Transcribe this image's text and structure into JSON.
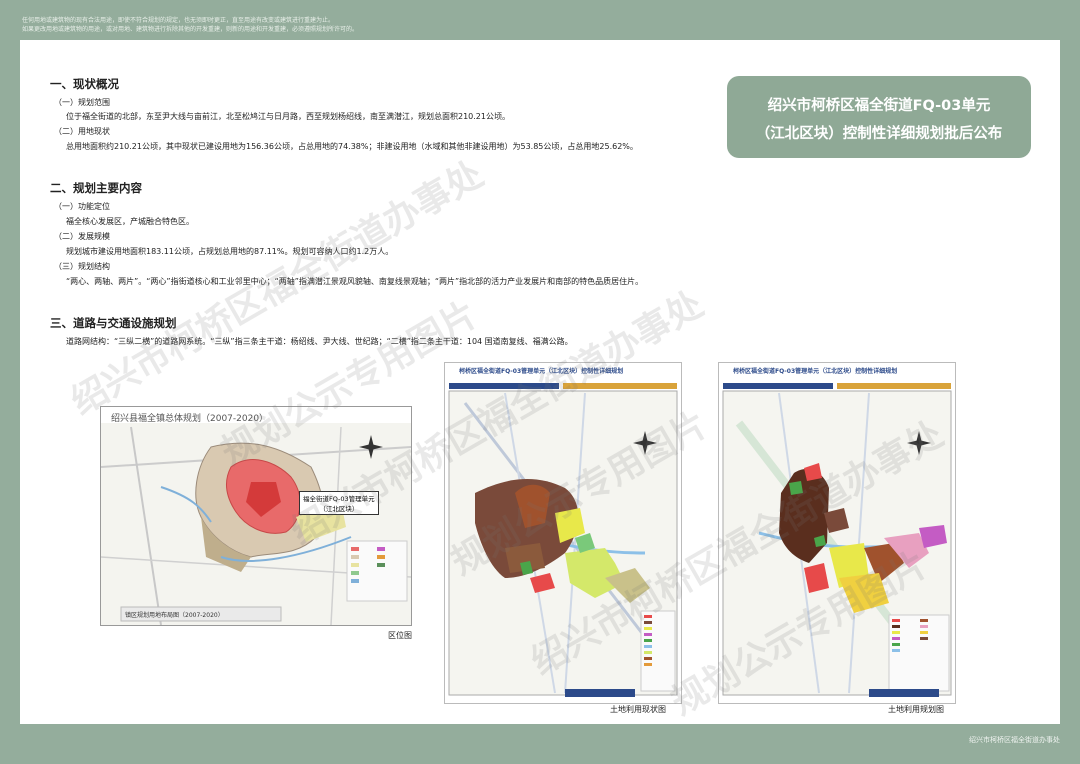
{
  "top_note": {
    "line1": "任何用地或建筑物的现有合法用途，即使不符合规划的规定，也无须即时更正，直至用途有改变或建筑进行重建为止。",
    "line2": "如果更改用地或建筑物的用途，或对用地、建筑物进行拆除其他的开发重建，则新的用途和开发重建，必须遵照规划所许可的。"
  },
  "title": {
    "line1": "绍兴市柯桥区福全街道FQ-03单元",
    "line2": "（江北区块）控制性详细规划批后公布"
  },
  "sections": {
    "s1": {
      "title": "一、现状概况",
      "sub1_label": "（一）规划范围",
      "sub1_text": "位于福全街道的北部，东至尹大线与亩前江，北至松鸠江与日月路，西至规划杨绍线，南至满潜江，规划总面积210.21公顷。",
      "sub2_label": "（二）用地现状",
      "sub2_text": "总用地面积约210.21公顷，其中现状已建设用地为156.36公顷，占总用地的74.38%；非建设用地（水域和其他非建设用地）为53.85公顷，占总用地25.62%。"
    },
    "s2": {
      "title": "二、规划主要内容",
      "sub1_label": "（一）功能定位",
      "sub1_text": "福全核心发展区，产城融合特色区。",
      "sub2_label": "（二）发展规模",
      "sub2_text": "规划城市建设用地面积183.11公顷，占规划总用地的87.11%。规划可容纳人口约1.2万人。",
      "sub3_label": "（三）规划结构",
      "sub3_text": "“两心、两轴、两片”。“两心”指街道核心和工业邻里中心；“两轴”指满潜江景观风貌轴、南复线景观轴；“两片”指北部的活力产业发展片和南部的特色品质居住片。"
    },
    "s3": {
      "title": "三、道路与交通设施规划",
      "text": "道路网结构：“三纵二横”的道路网系统。“三纵”指三条主干道：杨绍线、尹大线、世纪路；“二横”指二条主干道：104 国道南复线、福满公路。"
    }
  },
  "maps": {
    "map1": {
      "header": "绍兴县福全镇总体规划（2007-2020）",
      "callout_line1": "福全街道FQ-03管理单元",
      "callout_line2": "（江北区块）",
      "legend_title": "镇区规划用地布局图（2007-2020）",
      "caption": "区位图"
    },
    "map2": {
      "header": "柯桥区福全街道FQ-03管理单元（江北区块）控制性详细规划",
      "caption": "土地利用现状图"
    },
    "map3": {
      "header": "柯桥区福全街道FQ-03管理单元（江北区块）控制性详细规划",
      "caption": "土地利用规划图"
    }
  },
  "footer": "绍兴市柯桥区福全街道办事处",
  "watermark": {
    "line_a": "绍兴市柯桥区福全街道办事处",
    "line_b": "规划公示专用图片"
  },
  "colors": {
    "frame": "#94ad9c",
    "title_box": "#8fa996"
  }
}
